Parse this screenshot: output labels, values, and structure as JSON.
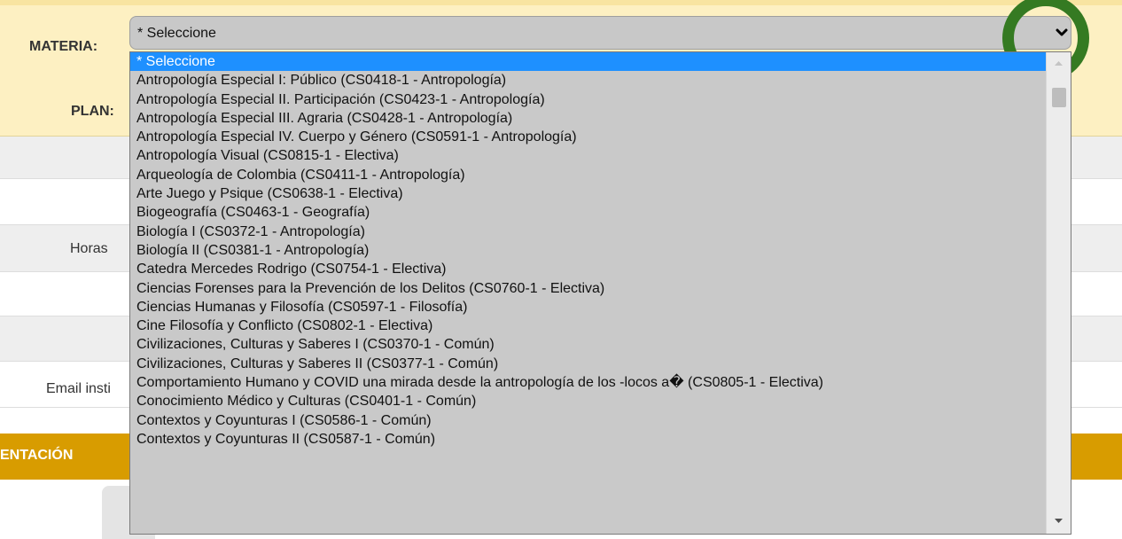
{
  "form": {
    "materia_label": "MATERIA:",
    "plan_label": "PLAN:",
    "select_value": "* Seleccione"
  },
  "background": {
    "horas_label": "Horas",
    "email_label": "Email insti",
    "section_title": "ENTACIÓN"
  },
  "dropdown": {
    "options": [
      "* Seleccione",
      "Antropología Especial I: Público (CS0418-1 - Antropología)",
      "Antropología Especial II. Participación (CS0423-1 - Antropología)",
      "Antropología Especial III. Agraria (CS0428-1 - Antropología)",
      "Antropología Especial IV. Cuerpo y Género (CS0591-1 - Antropología)",
      "Antropología Visual (CS0815-1 - Electiva)",
      "Arqueología de Colombia (CS0411-1 - Antropología)",
      "Arte Juego y Psique (CS0638-1 - Electiva)",
      "Biogeografía (CS0463-1 - Geografía)",
      "Biología I (CS0372-1 - Antropología)",
      "Biología II (CS0381-1 - Antropología)",
      "Catedra Mercedes Rodrigo (CS0754-1 - Electiva)",
      "Ciencias Forenses para la Prevención de los Delitos (CS0760-1 - Electiva)",
      "Ciencias Humanas y Filosofía (CS0597-1 - Filosofía)",
      "Cine Filosofía y Conflicto (CS0802-1 - Electiva)",
      "Civilizaciones, Culturas y Saberes I (CS0370-1 - Común)",
      "Civilizaciones, Culturas y Saberes II (CS0377-1 - Común)",
      "Comportamiento Humano y COVID una mirada desde la antropología de los -locos a� (CS0805-1 - Electiva)",
      "Conocimiento Médico y Culturas (CS0401-1 - Común)",
      "Contextos y Coyunturas I (CS0586-1 - Común)",
      "Contextos y Coyunturas II (CS0587-1 - Común)"
    ],
    "selected_index": 0
  },
  "colors": {
    "highlight": "#1e90ff",
    "annotation": "#357a22",
    "panel": "#fdf0c2",
    "section": "#d89c00"
  },
  "icons": {
    "dropdown": "chevron-down-icon",
    "scroll_up": "triangle-up-icon",
    "scroll_down": "triangle-down-icon"
  }
}
